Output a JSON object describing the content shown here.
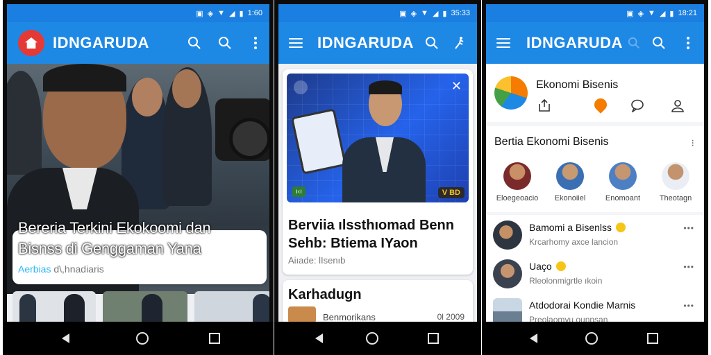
{
  "phone1": {
    "status_time": "1:60",
    "brand": "IDNGARUDA",
    "hero_title": "Bereria Terkini Ekokoomi dan Bisnss di Genggaman Yana",
    "hero_meta_a": "Aerbias",
    "hero_meta_b": "d\\,hnadiaris",
    "icons": [
      "search-icon",
      "search-icon",
      "more-vertical-icon"
    ]
  },
  "phone2": {
    "status_time": "35:33",
    "brand": "IDNGARUDA",
    "video_badge": "V BD",
    "video_badge_left": "ı‹ı",
    "card_title": "Berviia ılssthıomad Benn Sehb: Btiema IYaon",
    "card_meta": "Aiıade: lIsenıb",
    "section_title": "Karhadugn",
    "row_text": "Benmorikans",
    "row_date": "0l 2009",
    "icons": [
      "menu-icon",
      "search-icon",
      "accessibility-icon",
      "close-icon"
    ]
  },
  "phone3": {
    "status_time": "18:21",
    "brand": "IDNGARUDA",
    "channel_name": "Ekonomi Bisenis",
    "section_title": "Bertia Ekonomi Bisenis",
    "people": [
      {
        "name": "Eloegeoacio"
      },
      {
        "name": "Ekonoiiel"
      },
      {
        "name": "Enomoant"
      },
      {
        "name": "Theotagn"
      }
    ],
    "news": [
      {
        "title": "Bamomi a Bisenlss",
        "subtitle": "Krcarhomy axce lancion"
      },
      {
        "title": "Uaço",
        "subtitle": "Rleolonmigrtle ıkoin"
      },
      {
        "title": "Atdodorai Kondie Marnis",
        "subtitle": "Preolaomyu ounnsan"
      }
    ]
  },
  "colors": {
    "app_bar": "#1e88e5",
    "status_bar": "#1a7fe0",
    "nav_bar": "#000000",
    "accent_orange": "#f57c00",
    "emoji_yellow": "#f5c518"
  }
}
